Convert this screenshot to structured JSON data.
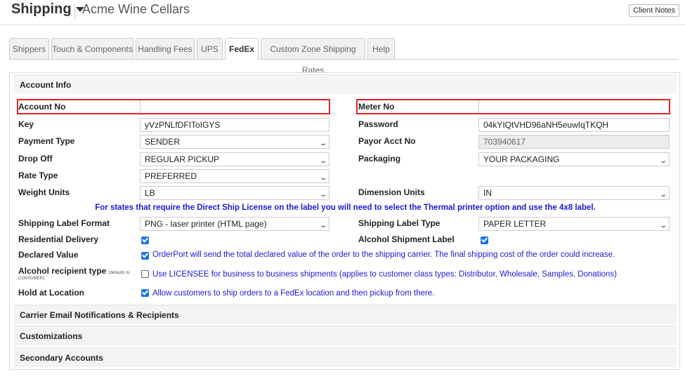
{
  "header": {
    "title": "Shipping",
    "company": "Acme Wine Cellars",
    "client_notes": "Client Notes"
  },
  "tabs": [
    {
      "label": "Shippers",
      "active": false
    },
    {
      "label": "Touch & Components",
      "active": false
    },
    {
      "label": "Handling Fees",
      "active": false
    },
    {
      "label": "UPS",
      "active": false
    },
    {
      "label": "FedEx",
      "active": true
    },
    {
      "label": "Custom Zone Shipping Rates",
      "active": false
    },
    {
      "label": "Help",
      "active": false
    }
  ],
  "account_info": {
    "heading": "Account Info",
    "account_no": {
      "label": "Account No",
      "value": ""
    },
    "meter_no": {
      "label": "Meter No",
      "value": ""
    },
    "key": {
      "label": "Key",
      "value": "yVzPNLfDFIToIGYS"
    },
    "password": {
      "label": "Password",
      "value": "04kYIQtVHD96aNH5euwIqTKQH"
    },
    "payment_type": {
      "label": "Payment Type",
      "value": "SENDER"
    },
    "payor_acct_no": {
      "label": "Payor Acct No",
      "value": "703940617"
    },
    "drop_off": {
      "label": "Drop Off",
      "value": "REGULAR PICKUP"
    },
    "packaging": {
      "label": "Packaging",
      "value": "YOUR PACKAGING"
    },
    "rate_type": {
      "label": "Rate Type",
      "value": "PREFERRED"
    },
    "weight_units": {
      "label": "Weight Units",
      "value": "LB"
    },
    "dimension_units": {
      "label": "Dimension Units",
      "value": "IN"
    },
    "direct_ship_note": "For states that require the Direct Ship License on the label you will need to select the Thermal printer option and use the 4x8 label.",
    "label_format": {
      "label": "Shipping Label Format",
      "value": "PNG - laser printer (HTML page)"
    },
    "label_type": {
      "label": "Shipping Label Type",
      "value": "PAPER LETTER"
    },
    "residential_delivery": {
      "label": "Residential Delivery",
      "checked": true
    },
    "alcohol_shipment_label": {
      "label": "Alcohol Shipment Label",
      "checked": true
    },
    "declared_value": {
      "label": "Declared Value",
      "checked": true,
      "text": "OrderPort will send the total declared value of the order to the shipping carrier. The final shipping cost of the order could increase."
    },
    "alcohol_recipient_type": {
      "label": "Alcohol recipient type",
      "hint": "(defaults to:",
      "hint2": "CONSUMER)",
      "checked": false,
      "text": "Use LICENSEE for business to business shipments (applies to customer class types: Distributor, Wholesale, Samples, Donations)"
    },
    "hold_at_location": {
      "label": "Hold at Location",
      "checked": true,
      "text": "Allow customers to ship orders to a FedEx location and then pickup from there."
    }
  },
  "sections": {
    "carrier_email": "Carrier Email Notifications & Recipients",
    "customizations": "Customizations",
    "secondary_accounts": "Secondary Accounts"
  },
  "colors": {
    "highlight": "#e32222",
    "note_blue": "#1a1ad6",
    "checkbox": "#1a73e8"
  }
}
